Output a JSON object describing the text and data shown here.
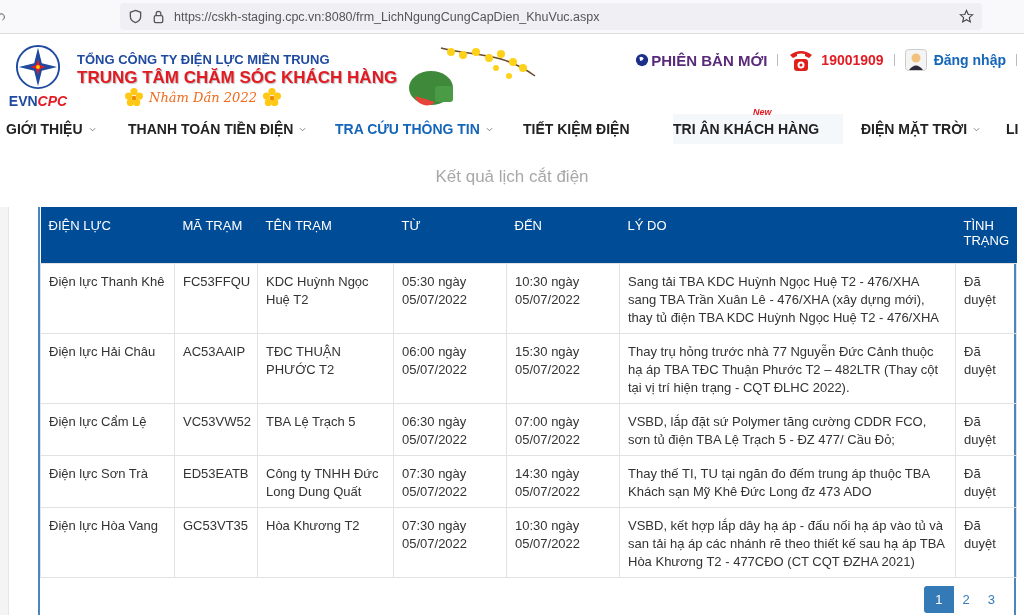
{
  "browser": {
    "url": "https://cskh-staging.cpc.vn:8080/frm_LichNgungCungCapDien_KhuVuc.aspx"
  },
  "header": {
    "logo_text": "EVN",
    "logo_text_accent": "CPC",
    "company": "TỔNG CÔNG TY ĐIỆN LỰC MIỀN TRUNG",
    "center": "TRUNG TÂM CHĂM SÓC KHÁCH HÀNG",
    "greeting": "Nhâm Dần 2022",
    "new_version": "PHIÊN BẢN MỚI",
    "hotline": "19001909",
    "login": "Đăng nhập"
  },
  "nav": [
    {
      "label": "GIỚI THIỆU",
      "dropdown": true,
      "selected": false
    },
    {
      "label": "THANH TOÁN TIỀN ĐIỆN",
      "dropdown": true,
      "selected": false
    },
    {
      "label": "TRA CỨU THÔNG TIN",
      "dropdown": true,
      "selected": true
    },
    {
      "label": "TIẾT KIỆM ĐIỆN",
      "dropdown": false,
      "selected": false
    },
    {
      "label": "TRI ÂN KHÁCH HÀNG",
      "dropdown": false,
      "selected": false,
      "badge": "New"
    },
    {
      "label": "ĐIỆN MẶT TRỜI",
      "dropdown": true,
      "selected": false
    },
    {
      "label": "LI",
      "dropdown": false,
      "selected": false
    }
  ],
  "page_title": "Kết quả lịch cắt điện",
  "table": {
    "columns": [
      "ĐIỆN LỰC",
      "MÃ TRẠM",
      "TÊN TRẠM",
      "TỪ",
      "ĐẾN",
      "LÝ DO",
      "TÌNH TRẠNG"
    ],
    "rows": [
      [
        "Điện lực Thanh Khê",
        "FC53FFQU",
        "KDC Huỳnh Ngọc Huệ T2",
        "05:30 ngày 05/07/2022",
        "10:30 ngày 05/07/2022",
        "Sang tải TBA KDC Huỳnh Ngọc Huệ T2 - 476/XHA sang TBA Trần Xuân Lê - 476/XHA (xây dựng mới), thay tủ điện TBA KDC Huỳnh Ngọc Huệ T2 - 476/XHA",
        "Đã duyệt"
      ],
      [
        "Điện lực Hải Châu",
        "AC53AAIP",
        "TĐC THUẬN PHƯỚC T2",
        "06:00 ngày 05/07/2022",
        "15:30 ngày 05/07/2022",
        "Thay trụ hỏng trước nhà 77 Nguyễn Đức Cảnh thuộc hạ áp TBA TĐC Thuận Phước T2 – 482LTR (Thay cột tại vị trí hiện trạng - CQT ĐLHC 2022).",
        "Đã duyệt"
      ],
      [
        "Điện lực Cẩm Lệ",
        "VC53VW52",
        "TBA Lệ Trạch 5",
        "06:30 ngày 05/07/2022",
        "07:00 ngày 05/07/2022",
        "VSBD, lắp đặt sứ Polymer tăng cường CDDR FCO, sơn tủ điện TBA Lệ Trạch 5 - ĐZ 477/ Cầu Đỏ;",
        "Đã duyệt"
      ],
      [
        "Điện lực Sơn Trà",
        "ED53EATB",
        "Công ty TNHH Đức Long Dung Quất",
        "07:30 ngày 05/07/2022",
        "14:30 ngày 05/07/2022",
        "Thay thế TI, TU tại ngăn đo đếm trung áp thuộc TBA Khách sạn Mỹ Khê Đức Long đz 473 ADO",
        "Đã duyệt"
      ],
      [
        "Điện lực Hòa Vang",
        "GC53VT35",
        "Hòa Khương T2",
        "07:30 ngày 05/07/2022",
        "10:30 ngày 05/07/2022",
        "VSBD, kết hợp lắp dây hạ áp - đấu nối hạ áp vào tủ và san tải hạ áp các nhánh rẽ theo thiết kế sau hạ áp TBA Hòa Khương T2 - 477CĐO (CT CQT ĐZHA 2021)",
        "Đã duyệt"
      ]
    ]
  },
  "pagination": [
    {
      "label": "1",
      "selected": true
    },
    {
      "label": "2",
      "selected": false
    },
    {
      "label": "3",
      "selected": false
    }
  ]
}
